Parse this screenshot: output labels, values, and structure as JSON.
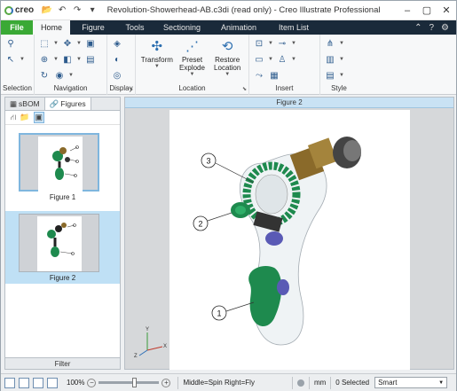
{
  "app": {
    "logo_text": "creo",
    "window_title": "Revolution-Showerhead-AB.c3di (read only) - Creo Illustrate Professional"
  },
  "tabs": [
    "File",
    "Home",
    "Figure",
    "Tools",
    "Sectioning",
    "Animation",
    "Item List"
  ],
  "ribbon": {
    "groups": {
      "selection": "Selection",
      "navigation": "Navigation",
      "display": "Display",
      "location": "Location",
      "insert": "Insert",
      "style": "Style"
    },
    "transform": "Transform",
    "preset_explode": "Preset\nExplode",
    "restore_location": "Restore\nLocation"
  },
  "left_panel": {
    "tabs": [
      "sBOM",
      "Figures"
    ],
    "figures": [
      "Figure 1",
      "Figure 2"
    ],
    "filter": "Filter"
  },
  "canvas": {
    "header": "Figure 2",
    "callouts": [
      "3",
      "2",
      "1"
    ],
    "axes": [
      "Y",
      "Z",
      "X"
    ]
  },
  "status": {
    "zoom": "100%",
    "zoom_level": 0.6,
    "nav_hint": "Middle=Spin  Right=Fly",
    "units": "mm",
    "selected": "0 Selected",
    "filter_mode": "Smart"
  },
  "colors": {
    "file_tab": "#3aa935",
    "ribbon_tabbar": "#1a2a3a",
    "selection_highlight": "#bfe0f5",
    "model_green": "#1e8a4e",
    "model_brass": "#8a6a2a"
  }
}
